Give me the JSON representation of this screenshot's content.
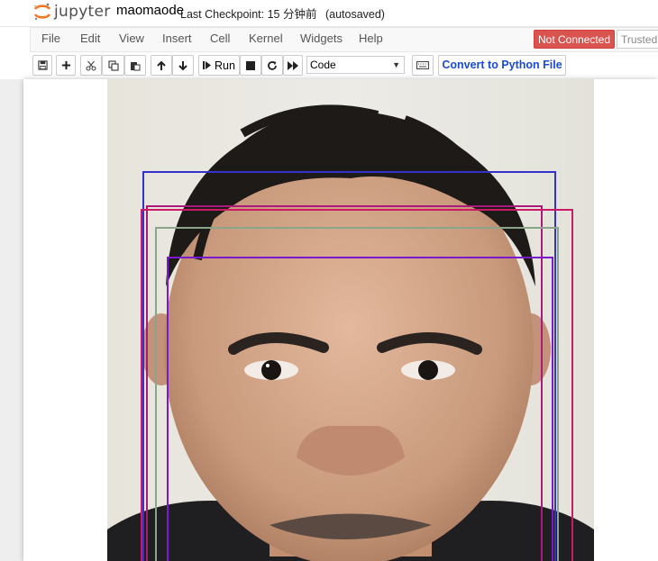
{
  "header": {
    "brand": "jupyter",
    "notebook_name": "maomaode",
    "checkpoint_label": "Last Checkpoint: 15 分钟前",
    "autosave_status": "(autosaved)"
  },
  "menu": {
    "items": [
      "File",
      "Edit",
      "View",
      "Insert",
      "Cell",
      "Kernel",
      "Widgets",
      "Help"
    ]
  },
  "status": {
    "kernel_indicator": "Not Connected",
    "trusted_indicator": "Trusted"
  },
  "toolbar": {
    "run_label": "Run",
    "cell_type_selected": "Code",
    "convert_label": "Convert to Python File",
    "buttons": [
      "save-icon",
      "plus-icon",
      "scissors-icon",
      "copy-icon",
      "paste-icon",
      "arrow-up-icon",
      "arrow-down-icon",
      "step-forward-icon",
      "stop-icon",
      "refresh-icon",
      "fast-forward-icon",
      "keyboard-icon"
    ]
  },
  "output": {
    "image_subject": "face photo with detection boxes",
    "box_colors": [
      "#3333cc",
      "#aa1a7a",
      "#cc1a66",
      "#8aa58a",
      "#7a1acc"
    ]
  }
}
